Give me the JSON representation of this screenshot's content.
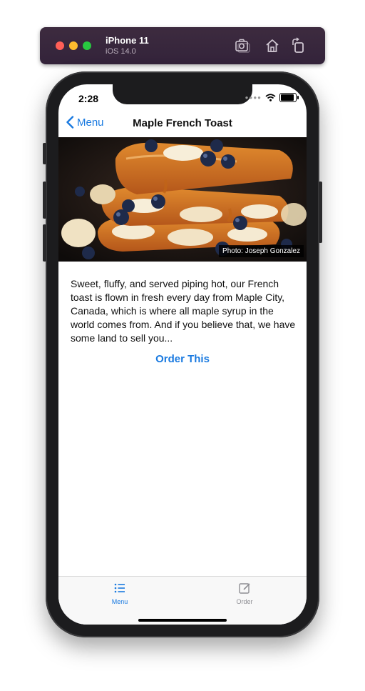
{
  "simulator": {
    "device": "iPhone 11",
    "os": "iOS 14.0",
    "icons": [
      "screenshot-icon",
      "home-icon",
      "rotate-icon"
    ]
  },
  "status_bar": {
    "time": "2:28",
    "icons": [
      "signal-dots-icon",
      "wifi-icon",
      "battery-icon"
    ]
  },
  "nav": {
    "back_label": "Menu",
    "title": "Maple French Toast"
  },
  "hero": {
    "photo_credit": "Photo: Joseph Gonzalez"
  },
  "description": "Sweet, fluffy, and served piping hot, our French toast is flown in fresh every day from Maple City, Canada, which is where all maple syrup in the world comes from. And if you believe that, we have some land to sell you...",
  "order_link": "Order This",
  "tabs": [
    {
      "label": "Menu",
      "icon": "list-icon",
      "selected": true
    },
    {
      "label": "Order",
      "icon": "edit-icon",
      "selected": false
    }
  ],
  "colors": {
    "accent": "#1a7ae0",
    "inactive": "#8e8e93"
  }
}
